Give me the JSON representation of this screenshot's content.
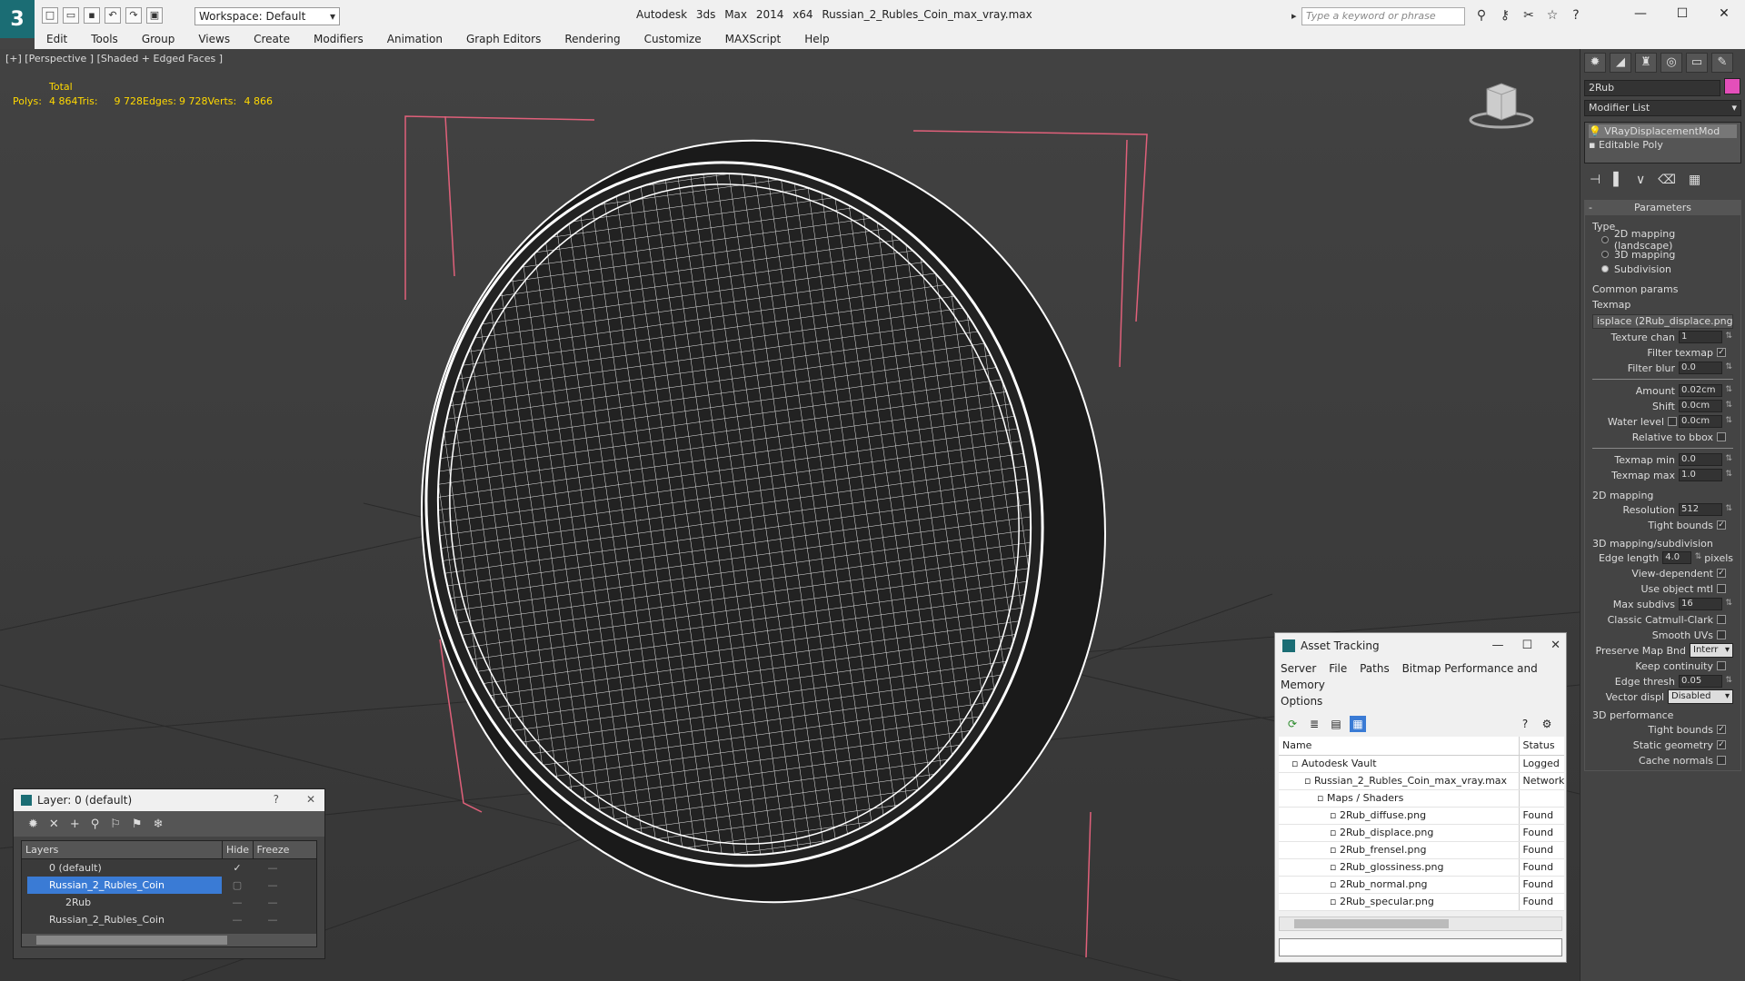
{
  "app": {
    "title": "Autodesk 3ds Max  2014 x64",
    "file": "Russian_2_Rubles_Coin_max_vray.max",
    "workspace": "Workspace: Default",
    "search_placeholder": "Type a keyword or phrase"
  },
  "menu": [
    "Edit",
    "Tools",
    "Group",
    "Views",
    "Create",
    "Modifiers",
    "Animation",
    "Graph Editors",
    "Rendering",
    "Customize",
    "MAXScript",
    "Help"
  ],
  "viewport": {
    "label": "[+] [Perspective ] [Shaded + Edged Faces ]",
    "stats_header": "Total",
    "stats": [
      {
        "k": "Polys:",
        "v": "4 864"
      },
      {
        "k": "Tris:",
        "v": "9 728"
      },
      {
        "k": "Edges:",
        "v": "9 728"
      },
      {
        "k": "Verts:",
        "v": "4 866"
      }
    ]
  },
  "panel": {
    "object_name": "2Rub",
    "object_color": "#e44fba",
    "modifier_list": "Modifier List",
    "stack": [
      "VRayDisplacementMod",
      "Editable Poly"
    ],
    "params_title": "Parameters",
    "type_label": "Type",
    "types": [
      "2D mapping (landscape)",
      "3D mapping",
      "Subdivision"
    ],
    "common_params": "Common params",
    "texmap_label": "Texmap",
    "texmap_value": "isplace (2Rub_displace.png)",
    "texture_chan": "Texture chan",
    "texture_chan_v": "1",
    "filter_texmap": "Filter texmap",
    "filter_blur": "Filter blur",
    "filter_blur_v": "0.0",
    "amount": "Amount",
    "amount_v": "0.02cm",
    "shift": "Shift",
    "shift_v": "0.0cm",
    "water_level": "Water level",
    "water_level_v": "0.0cm",
    "relative_bbox": "Relative to bbox",
    "texmap_min": "Texmap min",
    "texmap_min_v": "0.0",
    "texmap_max": "Texmap max",
    "texmap_max_v": "1.0",
    "mapping2d": "2D mapping",
    "resolution": "Resolution",
    "resolution_v": "512",
    "tight_bounds": "Tight bounds",
    "mapping3d": "3D mapping/subdivision",
    "edge_length": "Edge length",
    "edge_length_v": "4.0",
    "pixels": "pixels",
    "view_dependent": "View-dependent",
    "use_object_mtl": "Use object mtl",
    "max_subdivs": "Max subdivs",
    "max_subdivs_v": "16",
    "catmull": "Classic Catmull-Clark",
    "smooth_uvs": "Smooth UVs",
    "preserve_map": "Preserve Map Bnd",
    "preserve_map_v": "Interr",
    "keep_continuity": "Keep continuity",
    "edge_thresh": "Edge thresh",
    "edge_thresh_v": "0.05",
    "vector_displ": "Vector displ",
    "vector_displ_v": "Disabled",
    "perf": "3D performance",
    "perf_tight": "Tight bounds",
    "static_geo": "Static geometry",
    "cache_normals": "Cache normals"
  },
  "asset": {
    "title": "Asset Tracking",
    "menu": [
      "Server",
      "File",
      "Paths",
      "Bitmap Performance and Memory"
    ],
    "menu2": "Options",
    "col_name": "Name",
    "col_status": "Status",
    "rows": [
      {
        "name": "Autodesk Vault",
        "status": "Logged",
        "indent": 1
      },
      {
        "name": "Russian_2_Rubles_Coin_max_vray.max",
        "status": "Network",
        "indent": 2
      },
      {
        "name": "Maps / Shaders",
        "status": "",
        "indent": 3
      },
      {
        "name": "2Rub_diffuse.png",
        "status": "Found",
        "indent": 4
      },
      {
        "name": "2Rub_displace.png",
        "status": "Found",
        "indent": 4
      },
      {
        "name": "2Rub_frensel.png",
        "status": "Found",
        "indent": 4
      },
      {
        "name": "2Rub_glossiness.png",
        "status": "Found",
        "indent": 4
      },
      {
        "name": "2Rub_normal.png",
        "status": "Found",
        "indent": 4
      },
      {
        "name": "2Rub_specular.png",
        "status": "Found",
        "indent": 4
      }
    ]
  },
  "layer": {
    "title": "Layer: 0 (default)",
    "help": "?",
    "col_layers": "Layers",
    "col_hide": "Hide",
    "col_freeze": "Freeze",
    "rows": [
      "0 (default)",
      "Russian_2_Rubles_Coin",
      "2Rub",
      "Russian_2_Rubles_Coin"
    ]
  }
}
